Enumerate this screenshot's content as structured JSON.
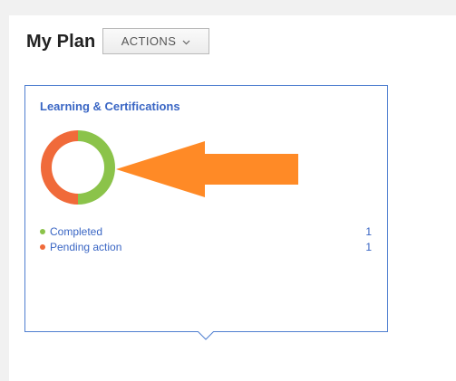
{
  "header": {
    "title": "My Plan",
    "actions_label": "ACTIONS"
  },
  "card": {
    "title": "Learning & Certifications",
    "legend": [
      {
        "label": "Completed",
        "count": "1",
        "color": "#8bc34a"
      },
      {
        "label": "Pending action",
        "count": "1",
        "color": "#f06a3a"
      }
    ]
  },
  "chart_data": {
    "type": "pie",
    "categories": [
      "Completed",
      "Pending action"
    ],
    "values": [
      1,
      1
    ],
    "colors": [
      "#8bc34a",
      "#f06a3a"
    ]
  },
  "annotation": {
    "arrow_color": "#ff8a26"
  }
}
